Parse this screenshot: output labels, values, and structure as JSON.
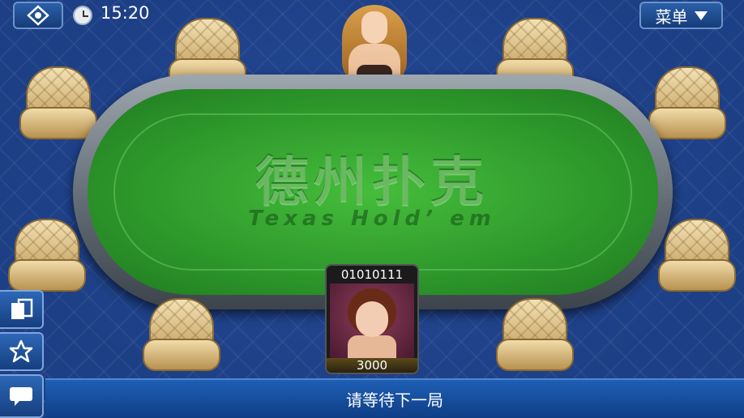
{
  "topbar": {
    "time": "15:20",
    "menu_label": "菜单"
  },
  "table": {
    "title_cn": "德州扑克",
    "title_en": "Texas Hold’ em"
  },
  "player": {
    "name": "01010111",
    "chips": "3000"
  },
  "status": {
    "message": "请等待下一局"
  },
  "icons": [
    "logo-icon",
    "clock-icon",
    "chevron-down-icon",
    "pages-icon",
    "star-icon",
    "chat-icon"
  ],
  "colors": {
    "background": "#1d3f86",
    "felt": "#2f9a2c",
    "button": "#1e5fb5"
  }
}
